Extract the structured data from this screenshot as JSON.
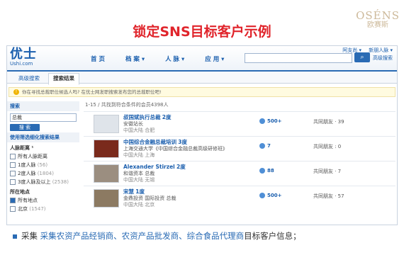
{
  "slide": {
    "title": "锁定SNS目标客户示例",
    "brand_en": "OSÉNS",
    "brand_cn": "欧赛斯",
    "bullet": {
      "lead": "采集",
      "highlight": "采集农资产品经销商、农资产品批发商、综合食品代理商",
      "tail": "目标客户信息；"
    }
  },
  "site": {
    "logo_text": "优士",
    "logo_url": "Ushi.com",
    "nav": [
      "首 页",
      "档 案 ▾",
      "人 脉 ▾",
      "应 用 ▾"
    ],
    "top_links": [
      "阿支尚 ▾",
      "新朋人脉 ▾"
    ],
    "search_placeholder": "",
    "search_button_icon": "search-icon",
    "advanced_link": "高级搜索",
    "tabs": [
      "高级搜索",
      "搜索结果"
    ],
    "notice": "你在寻找总裁职位候选人吗? 在优士网发职搜索发布您的总裁职位吧!",
    "sidebar": {
      "search_title": "搜索",
      "keyword": "总裁",
      "search_btn": "搜 索",
      "filter_title": "使用筛选细化搜索结果",
      "group1_title": "人脉距离 ¹",
      "group1": [
        {
          "label": "所有人脉距离",
          "count": ""
        },
        {
          "label": "1度人脉",
          "count": "(56)"
        },
        {
          "label": "2度人脉",
          "count": "(1804)"
        },
        {
          "label": "3度人脉及以上",
          "count": "(2538)"
        }
      ],
      "group2_title": "所在地点",
      "group2": [
        {
          "label": "所有地点",
          "count": ""
        },
        {
          "label": "北京",
          "count": "(1547)"
        }
      ]
    },
    "results_count": "1-15 / 共找到符合条件的会员4398人",
    "results": [
      {
        "name": "叔国斌执行总裁",
        "degree": "2度",
        "line1": "安徽站长",
        "line2": "中国大陆 合肥",
        "connections": "500+",
        "common": "共同朋友 · 39"
      },
      {
        "name": "中国综合金融总裁培训",
        "degree": "3度",
        "line1": "上海交通大学《中国综合金融总裁高级研修班》",
        "line2": "中国大陆 上海",
        "connections": "7",
        "common": "共同朋友 : 0"
      },
      {
        "name": "Alexander Stirzel",
        "degree": "2度",
        "line1": "和谐资本 总裁",
        "line2": "中国大陆 无锡",
        "connections": "88",
        "common": "共同朋友 · 7"
      },
      {
        "name": "宋慧",
        "degree": "1度",
        "line1": "金鼎投资 国际投资 总裁",
        "line2": "中国大陆 北京",
        "connections": "500+",
        "common": "共同朋友 · 57"
      }
    ]
  }
}
